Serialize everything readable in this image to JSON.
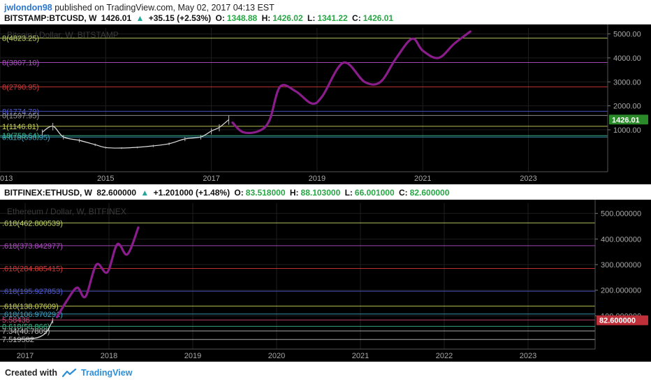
{
  "header": {
    "author": "jwlondon98",
    "text": "published on TradingView.com, May 02, 2017 04:13 EST"
  },
  "footer": {
    "created": "Created with",
    "brand": "TradingView"
  },
  "colors": {
    "up": "#26a69a",
    "price_label_btc": "#2a8a2a",
    "price_label_eth": "#c0303a",
    "drawing": "#8a1c8c"
  },
  "panel1": {
    "quote": {
      "symbol": "BITSTAMP:BTCUSD, W",
      "last": "1426.01",
      "change": "+35.15 (+2.53%)",
      "o_label": "O:",
      "o": "1348.88",
      "h_label": "H:",
      "h": "1426.02",
      "l_label": "L:",
      "l": "1341.22",
      "c_label": "C:",
      "c": "1426.01"
    },
    "watermark": "Bitcoin / Dollar, W, BITSTAMP",
    "price_label": "1426.01"
  },
  "panel2": {
    "quote": {
      "symbol": "BITFINEX:ETHUSD, W",
      "last": "82.600000",
      "change": "+1.201000 (+1.48%)",
      "o_label": "O:",
      "o": "83.518000",
      "h_label": "H:",
      "h": "88.103000",
      "l_label": "L:",
      "l": "66.001000",
      "c_label": "C:",
      "c": "82.600000"
    },
    "watermark": "Ethereum / Dollar, W, BITFINEX",
    "price_label": "82.600000"
  },
  "chart_data": [
    {
      "type": "line",
      "x_ticks": [
        "013",
        "2015",
        "2017",
        "2019",
        "2021",
        "2023"
      ],
      "y_ticks": [
        "5000.00",
        "4000.00",
        "3000.00",
        "2000.00",
        "1000.00"
      ],
      "ylim": [
        -750,
        5250
      ],
      "x_range": [
        2013,
        2024.5
      ],
      "levels": [
        {
          "label": "8(4823.25)",
          "value": 4823.25,
          "color": "#c2d66a"
        },
        {
          "label": "8(3807.10)",
          "value": 3807.1,
          "color": "#b04fc6"
        },
        {
          "label": "8(2790.95)",
          "value": 2790.95,
          "color": "#d23a3a"
        },
        {
          "label": "8(1774.79)",
          "value": 1774.79,
          "color": "#4f5ad0"
        },
        {
          "label": "0(1597.95)",
          "value": 1597.95,
          "color": "#9a9a9a"
        },
        {
          "label": "1(1146.81)",
          "value": 1146.81,
          "color": "#cad25a"
        },
        {
          "label": "18(758.64)",
          "value": 758.64,
          "color": "#3cb88a"
        },
        {
          "label": "0.618(698.95)",
          "value": 698.95,
          "color": "#3fa0c0"
        }
      ],
      "series": [
        {
          "values": [
            [
              2013.8,
              900
            ],
            [
              2014.0,
              1150
            ],
            [
              2014.2,
              700
            ],
            [
              2014.5,
              560
            ],
            [
              2014.8,
              380
            ],
            [
              2015.0,
              260
            ],
            [
              2015.3,
              240
            ],
            [
              2015.6,
              270
            ],
            [
              2015.9,
              330
            ],
            [
              2016.2,
              420
            ],
            [
              2016.5,
              620
            ],
            [
              2016.8,
              700
            ],
            [
              2017.0,
              950
            ],
            [
              2017.15,
              1100
            ],
            [
              2017.33,
              1426
            ]
          ]
        },
        {
          "values": [
            [
              2017.4,
              1300
            ],
            [
              2017.6,
              900
            ],
            [
              2017.9,
              950
            ],
            [
              2018.1,
              1400
            ],
            [
              2018.3,
              2800
            ],
            [
              2018.6,
              2600
            ],
            [
              2018.9,
              2100
            ],
            [
              2019.1,
              2400
            ],
            [
              2019.5,
              3800
            ],
            [
              2019.9,
              3000
            ],
            [
              2020.2,
              3000
            ],
            [
              2020.5,
              4000
            ],
            [
              2020.8,
              4800
            ],
            [
              2021.0,
              4300
            ],
            [
              2021.3,
              4000
            ],
            [
              2021.6,
              4600
            ],
            [
              2021.9,
              5100
            ]
          ]
        }
      ]
    },
    {
      "type": "line",
      "x_ticks": [
        "2017",
        "2018",
        "2019",
        "2020",
        "2021",
        "2022",
        "2023"
      ],
      "y_ticks": [
        "500.000000",
        "400.000000",
        "300.000000",
        "200.000000",
        "100.000000"
      ],
      "ylim": [
        -30,
        540
      ],
      "x_range": [
        2016.7,
        2023.8
      ],
      "levels": [
        {
          "label": ".618(462.800539)",
          "value": 462.800539,
          "color": "#c2d66a"
        },
        {
          "label": ".618(373.842977)",
          "value": 373.842977,
          "color": "#b04fc6"
        },
        {
          "label": ".618(284.885415)",
          "value": 284.885415,
          "color": "#d23a3a"
        },
        {
          "label": ".618(195.927853)",
          "value": 195.927853,
          "color": "#4f5ad0"
        },
        {
          "label": ".618(138.07609)",
          "value": 138.07609,
          "color": "#cad25a"
        },
        {
          "label": ".618(106.970291)",
          "value": 106.970291,
          "color": "#3fa0c0"
        },
        {
          "label": "5.58436",
          "value": 84,
          "color": "#c94a7a"
        },
        {
          "label": "0.618(58.866)",
          "value": 58.866,
          "color": "#3cb88a"
        },
        {
          "label": "7.34(40.7809)",
          "value": 40.7809,
          "color": "#bbbbbb"
        },
        {
          "label": "7.519582",
          "value": 7.519582,
          "color": "#bbbbbb"
        }
      ],
      "series": [
        {
          "values": [
            [
              2016.85,
              8
            ],
            [
              2017.0,
              10
            ],
            [
              2017.15,
              15
            ],
            [
              2017.25,
              35
            ],
            [
              2017.33,
              82.6
            ]
          ]
        },
        {
          "values": [
            [
              2017.38,
              95
            ],
            [
              2017.5,
              160
            ],
            [
              2017.62,
              210
            ],
            [
              2017.72,
              175
            ],
            [
              2017.85,
              300
            ],
            [
              2017.98,
              270
            ],
            [
              2018.1,
              380
            ],
            [
              2018.22,
              340
            ],
            [
              2018.35,
              445
            ]
          ]
        }
      ]
    }
  ]
}
